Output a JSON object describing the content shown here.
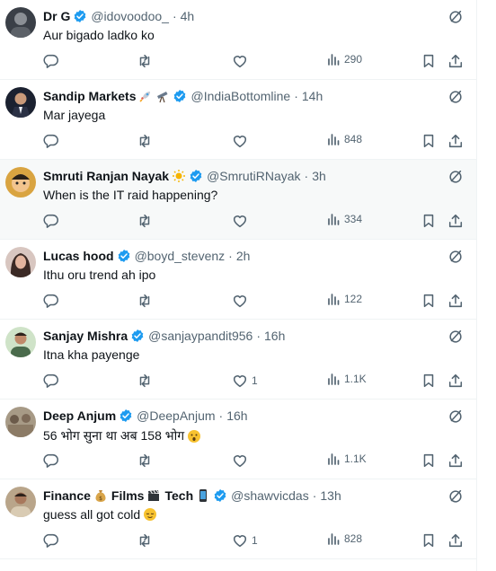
{
  "colors": {
    "verified": "#1d9bf0",
    "secondary_text": "#536471",
    "highlight_row": "#f7f9f9"
  },
  "tweets": [
    {
      "name": "Dr G",
      "emojis": [],
      "handle": "@idovoodoo_",
      "dot": "·",
      "time": "4h",
      "text": "Aur bigado ladko ko",
      "text_emoji": "",
      "likes": "",
      "views": "290",
      "highlighted": false,
      "avatar_icon": "avatar-dark"
    },
    {
      "name": "Sandip Markets",
      "emojis": [
        "rocket-emoji",
        "telescope-emoji"
      ],
      "handle": "@IndiaBottomline",
      "dot": "·",
      "time": "14h",
      "text": "Mar jayega",
      "text_emoji": "",
      "likes": "",
      "views": "848",
      "highlighted": false,
      "avatar_icon": "avatar-man-suit"
    },
    {
      "name": "Smruti Ranjan Nayak",
      "emojis": [
        "sun-emoji"
      ],
      "handle": "@SmrutiRNayak",
      "dot": "·",
      "time": "3h",
      "text": "When is the IT raid happening?",
      "text_emoji": "",
      "likes": "",
      "views": "334",
      "highlighted": true,
      "avatar_icon": "avatar-cartoon"
    },
    {
      "name": "Lucas hood",
      "emojis": [],
      "handle": "@boyd_stevenz",
      "dot": "·",
      "time": "2h",
      "text": "Ithu oru trend ah ipo",
      "text_emoji": "",
      "likes": "",
      "views": "122",
      "highlighted": false,
      "avatar_icon": "avatar-woman"
    },
    {
      "name": "Sanjay Mishra",
      "emojis": [],
      "handle": "@sanjaypandit956",
      "dot": "·",
      "time": "16h",
      "text": "Itna kha payenge",
      "text_emoji": "",
      "likes": "1",
      "views": "1.1K",
      "highlighted": false,
      "avatar_icon": "avatar-man-green"
    },
    {
      "name": "Deep Anjum",
      "emojis": [],
      "handle": "@DeepAnjum",
      "dot": "·",
      "time": "16h",
      "text": "56 भोग सुना था अब 158 भोग",
      "text_emoji": "surprised-face-emoji",
      "likes": "",
      "views": "1.1K",
      "highlighted": false,
      "avatar_icon": "avatar-crowd"
    },
    {
      "name": "Finance",
      "name2": "Films",
      "name3": "Tech",
      "emojis": [
        "money-bag-emoji",
        "clapper-emoji",
        "phone-emoji"
      ],
      "handle": "@shawvicdas",
      "dot": "·",
      "time": "13h",
      "text": "guess all got cold",
      "text_emoji": "relieved-face-emoji",
      "likes": "1",
      "views": "828",
      "highlighted": false,
      "avatar_icon": "avatar-man-beige"
    }
  ]
}
